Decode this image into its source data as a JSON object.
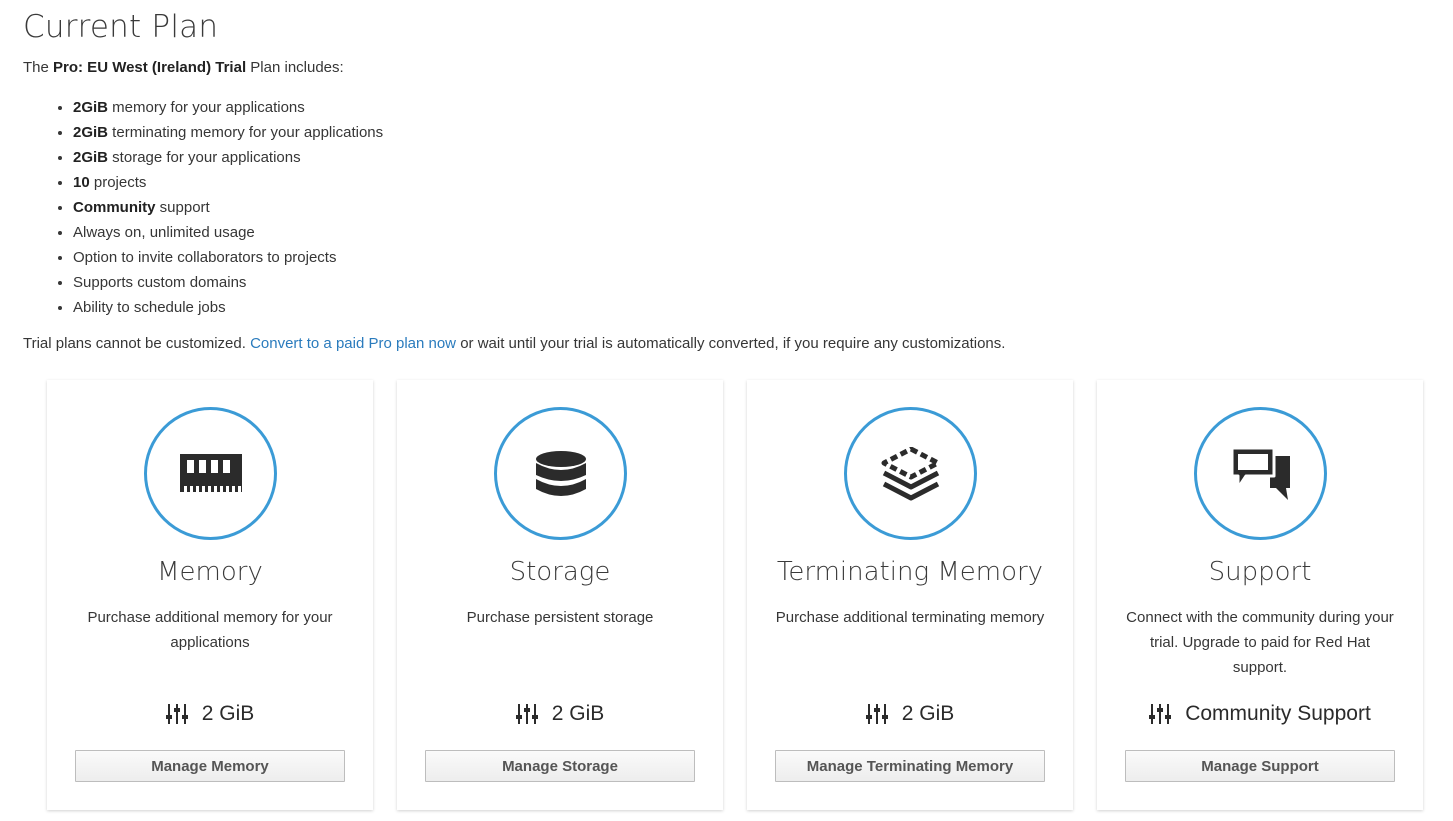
{
  "page": {
    "title": "Current Plan",
    "intro": {
      "prefix": "The ",
      "plan_name": "Pro: EU West (Ireland) Trial",
      "suffix": " Plan includes:"
    },
    "features": [
      {
        "bold": "2GiB",
        "text": " memory for your applications"
      },
      {
        "bold": "2GiB",
        "text": " terminating memory for your applications"
      },
      {
        "bold": "2GiB",
        "text": " storage for your applications"
      },
      {
        "bold": "10",
        "text": " projects"
      },
      {
        "bold": "Community",
        "text": " support"
      },
      {
        "bold": "",
        "text": "Always on, unlimited usage"
      },
      {
        "bold": "",
        "text": "Option to invite collaborators to projects"
      },
      {
        "bold": "",
        "text": "Supports custom domains"
      },
      {
        "bold": "",
        "text": "Ability to schedule jobs"
      }
    ],
    "trial_note": {
      "prefix": "Trial plans cannot be customized. ",
      "link": "Convert to a paid Pro plan now",
      "suffix": " or wait until your trial is automatically converted, if you require any customizations."
    }
  },
  "theme": {
    "accent": "#3b9bd6",
    "link": "#2a7bbd",
    "icon": "#2b2b2b"
  },
  "cards": [
    {
      "icon": "memory-icon",
      "title": "Memory",
      "description": "Purchase additional memory for your applications",
      "value": "2 GiB",
      "button": "Manage Memory"
    },
    {
      "icon": "storage-icon",
      "title": "Storage",
      "description": "Purchase persistent storage",
      "value": "2 GiB",
      "button": "Manage Storage"
    },
    {
      "icon": "layers-icon",
      "title": "Terminating Memory",
      "description": "Purchase additional terminating memory",
      "value": "2 GiB",
      "button": "Manage Terminating Memory"
    },
    {
      "icon": "chat-icon",
      "title": "Support",
      "description": "Connect with the community during your trial. Upgrade to paid for Red Hat support.",
      "value": "Community Support",
      "button": "Manage Support"
    }
  ]
}
